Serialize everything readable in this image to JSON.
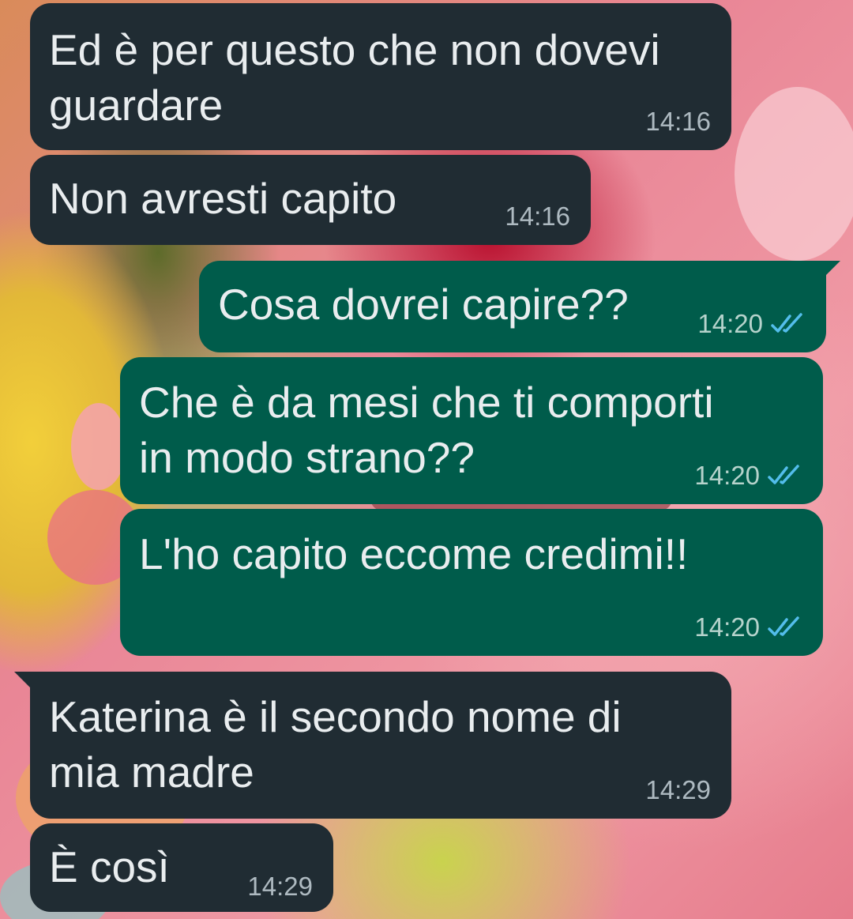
{
  "messages": [
    {
      "direction": "incoming",
      "text_lines": [
        "Ed è per questo che non dovevi",
        "guardare"
      ],
      "time": "14:16"
    },
    {
      "direction": "incoming",
      "text_lines": [
        "Non avresti capito"
      ],
      "time": "14:16"
    },
    {
      "direction": "outgoing",
      "text_lines": [
        "Cosa dovrei capire??"
      ],
      "time": "14:20",
      "status": "read"
    },
    {
      "direction": "outgoing",
      "text_lines": [
        "Che è da mesi che ti comporti",
        "in modo strano??"
      ],
      "time": "14:20",
      "status": "read"
    },
    {
      "direction": "outgoing",
      "text_lines": [
        "L'ho capito eccome credimi!!"
      ],
      "time": "14:20",
      "status": "read"
    },
    {
      "direction": "incoming",
      "text_lines": [
        "Katerina è il secondo nome di",
        "mia madre"
      ],
      "time": "14:29"
    },
    {
      "direction": "incoming",
      "text_lines": [
        "È così"
      ],
      "time": "14:29"
    }
  ],
  "icons": {
    "read_receipt": "double-check-icon"
  },
  "colors": {
    "incoming_bubble": "#202c33",
    "outgoing_bubble": "#005c4b",
    "message_text": "#e9edef",
    "timestamp": "#aebac1",
    "read_tick": "#53bdeb"
  }
}
